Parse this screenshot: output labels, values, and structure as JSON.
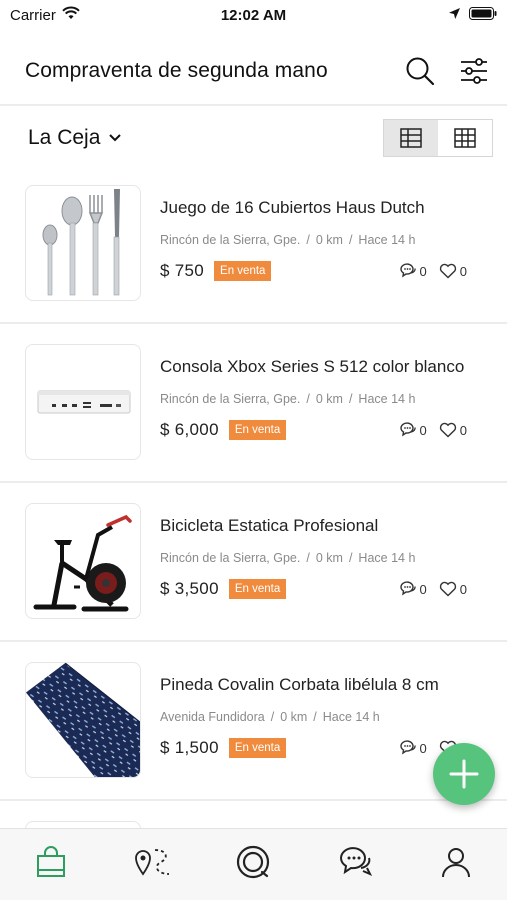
{
  "status_bar": {
    "carrier": "Carrier",
    "time": "12:02 AM"
  },
  "header": {
    "title": "Compraventa de segunda mano"
  },
  "filters": {
    "location": "La Ceja"
  },
  "listings": [
    {
      "title": "Juego de 16 Cubiertos Haus Dutch",
      "place": "Rincón de la Sierra, Gpe.",
      "distance": "0 km",
      "time": "Hace 14 h",
      "price": "$ 750",
      "status": "En venta",
      "comments": "0",
      "likes": "0"
    },
    {
      "title": "Consola Xbox Series S 512 color blanco",
      "place": "Rincón de la Sierra, Gpe.",
      "distance": "0 km",
      "time": "Hace 14 h",
      "price": "$ 6,000",
      "status": "En venta",
      "comments": "0",
      "likes": "0"
    },
    {
      "title": "Bicicleta Estatica Profesional",
      "place": "Rincón de la Sierra, Gpe.",
      "distance": "0 km",
      "time": "Hace 14 h",
      "price": "$ 3,500",
      "status": "En venta",
      "comments": "0",
      "likes": "0"
    },
    {
      "title": "Pineda Covalin Corbata libélula 8 cm",
      "place": "Avenida Fundidora",
      "distance": "0 km",
      "time": "Hace 14 h",
      "price": "$ 1,500",
      "status": "En venta",
      "comments": "0",
      "likes": "0"
    }
  ],
  "meta_separator": "/",
  "colors": {
    "accent": "#56c47c",
    "badge": "#f08a3c",
    "nav_active": "#2e9e5e"
  },
  "bottom_nav": [
    "shopping-bag-icon",
    "route-map-icon",
    "circle-icon",
    "chat-icon",
    "profile-icon"
  ]
}
